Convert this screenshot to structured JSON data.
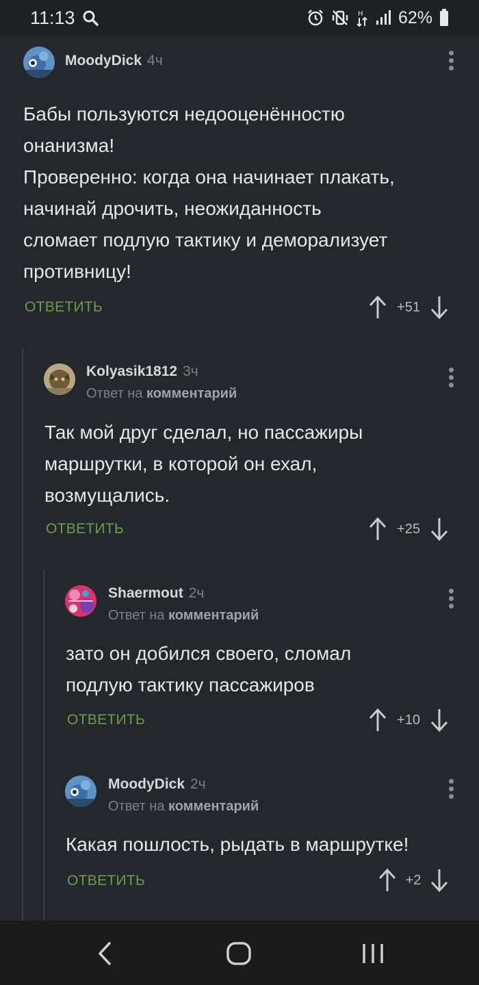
{
  "status_bar": {
    "time": "11:13",
    "battery": "62%",
    "icons": [
      "search-icon",
      "alarm-icon",
      "vibrate-icon",
      "data-arrows-icon",
      "signal-icon",
      "battery-icon"
    ]
  },
  "colors": {
    "background": "#24282c",
    "accent_green": "#6d9c4c",
    "muted_text": "#7c8187"
  },
  "comments": [
    {
      "username": "MoodyDick",
      "time": "4ч",
      "reply_to_label": "",
      "reply_to_target": "",
      "lines": [
        "Бабы пользуются недооценённостю",
        "онанизма!",
        "Проверенно: когда она начинает плакать,",
        "начинай дрочить, неожиданность",
        "сломает подлую тактику и деморализует",
        "противницу!"
      ],
      "reply_label": "ОТВЕТИТЬ",
      "score": "+51"
    },
    {
      "username": "Kolyasik1812",
      "time": "3ч",
      "reply_to_label": "Ответ на",
      "reply_to_target": "комментарий",
      "lines": [
        "Так мой друг сделал, но пассажиры",
        "маршрутки, в которой он ехал,",
        "возмущались."
      ],
      "reply_label": "ОТВЕТИТЬ",
      "score": "+25"
    },
    {
      "username": "Shaermout",
      "time": "2ч",
      "reply_to_label": "Ответ на",
      "reply_to_target": "комментарий",
      "lines": [
        "зато он добился своего, сломал",
        "подлую тактику пассажиров"
      ],
      "reply_label": "ОТВЕТИТЬ",
      "score": "+10"
    },
    {
      "username": "MoodyDick",
      "time": "2ч",
      "reply_to_label": "Ответ на",
      "reply_to_target": "комментарий",
      "lines": [
        "Какая пошлость, рыдать в маршрутке!"
      ],
      "reply_label": "ОТВЕТИТЬ",
      "score": "+2"
    }
  ],
  "nav_bar": {
    "icons": [
      "back-icon",
      "home-icon",
      "recents-icon"
    ]
  }
}
